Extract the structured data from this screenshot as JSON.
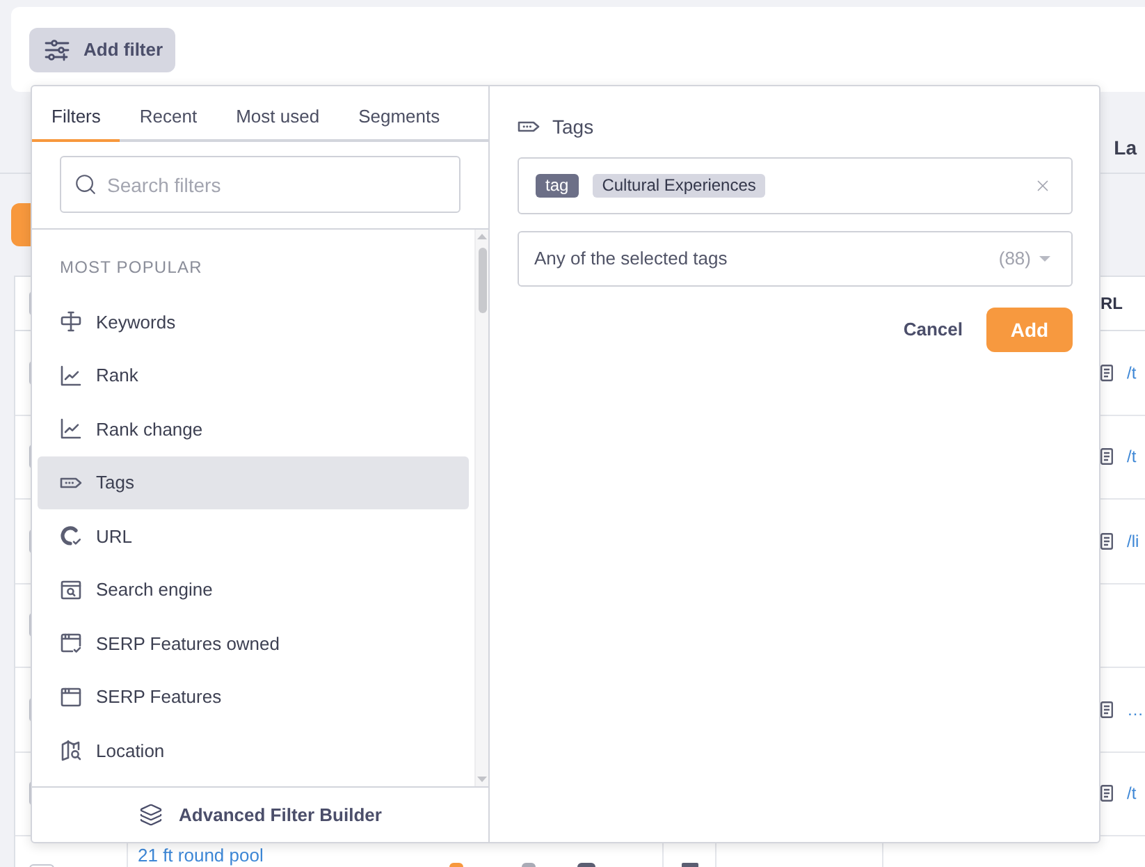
{
  "filter_bar": {
    "add_filter_button": "Add filter"
  },
  "background_table": {
    "section_header": "La",
    "select_all_checked": false,
    "url_column_header": "RL",
    "rows": [
      {
        "checked": false,
        "url": "/t"
      },
      {
        "checked": false,
        "url": "/t"
      },
      {
        "checked": false,
        "url": "/li"
      },
      {
        "checked": false
      },
      {
        "checked": false,
        "url": "…"
      },
      {
        "checked": false,
        "url": "/t"
      },
      {
        "checked": false,
        "keyword": "21 ft round pool"
      }
    ]
  },
  "filter_popover": {
    "tabs": [
      {
        "label": "Filters",
        "selected": true
      },
      {
        "label": "Recent",
        "selected": false
      },
      {
        "label": "Most used",
        "selected": false
      },
      {
        "label": "Segments",
        "selected": false
      }
    ],
    "search": {
      "placeholder": "Search filters"
    },
    "section_heading": "MOST POPULAR",
    "items": [
      {
        "label": "Keywords",
        "selected": false
      },
      {
        "label": "Rank",
        "selected": false
      },
      {
        "label": "Rank change",
        "selected": false
      },
      {
        "label": "Tags",
        "selected": true
      },
      {
        "label": "URL",
        "selected": false
      },
      {
        "label": "Search engine",
        "selected": false
      },
      {
        "label": "SERP Features owned",
        "selected": false
      },
      {
        "label": "SERP Features",
        "selected": false
      },
      {
        "label": "Location",
        "selected": false
      }
    ],
    "footer_button": "Advanced Filter Builder"
  },
  "tag_filter": {
    "title": "Tags",
    "chips": [
      {
        "kind": "type",
        "text": "tag"
      },
      {
        "kind": "value",
        "text": "Cultural Experiences"
      }
    ],
    "match_select": {
      "value": "Any of the selected tags",
      "count": "(88)"
    },
    "buttons": {
      "cancel": "Cancel",
      "add": "Add"
    }
  }
}
